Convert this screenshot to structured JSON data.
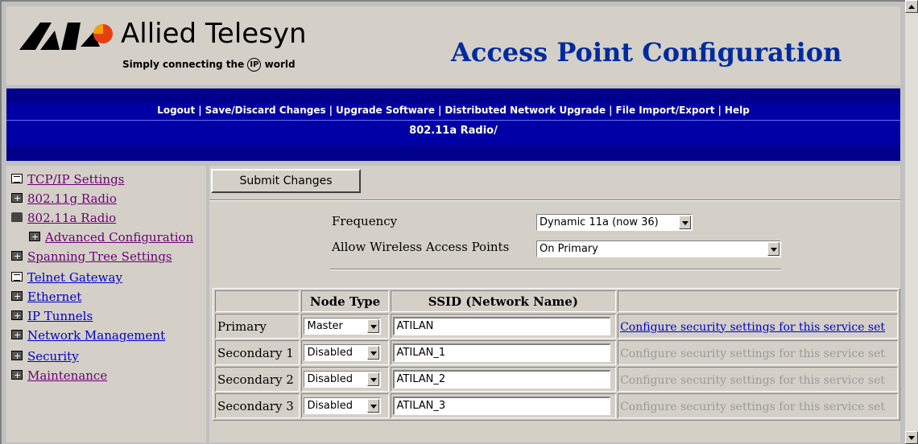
{
  "header": {
    "brand_name": "Allied Telesyn",
    "tagline_pre": "Simply connecting the",
    "tagline_ip": "IP",
    "tagline_post": "world",
    "page_title": "Access Point Configuration"
  },
  "topnav": {
    "links": [
      "Logout",
      "Save/Discard Changes",
      "Upgrade Software",
      "Distributed Network Upgrade",
      "File Import/Export",
      "Help"
    ],
    "section": "802.11a Radio/"
  },
  "sidebar": {
    "items": [
      {
        "label": "TCP/IP Settings",
        "icon": "document-icon"
      },
      {
        "label": "802.11g Radio",
        "icon": "folder-plus-icon"
      },
      {
        "label": "802.11a Radio",
        "icon": "folder-open-icon"
      },
      {
        "label": "Advanced Configuration",
        "icon": "folder-plus-icon"
      },
      {
        "label": "Spanning Tree Settings",
        "icon": "folder-plus-icon"
      },
      {
        "label": "Telnet Gateway",
        "icon": "document-icon"
      },
      {
        "label": "Ethernet",
        "icon": "folder-plus-icon"
      },
      {
        "label": "IP Tunnels",
        "icon": "folder-plus-icon"
      },
      {
        "label": "Network Management",
        "icon": "folder-plus-icon"
      },
      {
        "label": "Security",
        "icon": "folder-plus-icon"
      },
      {
        "label": "Maintenance",
        "icon": "folder-plus-icon"
      }
    ]
  },
  "main": {
    "submit_label": "Submit Changes",
    "frequency_label": "Frequency",
    "frequency_value": "Dynamic 11a (now 36)",
    "allow_label": "Allow Wireless Access Points",
    "allow_value": "On Primary",
    "table": {
      "headers": [
        "",
        "Node Type",
        "SSID (Network Name)",
        ""
      ],
      "rows": [
        {
          "name": "Primary",
          "node_type": "Master",
          "ssid": "ATILAN",
          "link": "Configure security settings for this service set",
          "enabled": true
        },
        {
          "name": "Secondary 1",
          "node_type": "Disabled",
          "ssid": "ATILAN_1",
          "link": "Configure security settings for this service set",
          "enabled": false
        },
        {
          "name": "Secondary 2",
          "node_type": "Disabled",
          "ssid": "ATILAN_2",
          "link": "Configure security settings for this service set",
          "enabled": false
        },
        {
          "name": "Secondary 3",
          "node_type": "Disabled",
          "ssid": "ATILAN_3",
          "link": "Configure security settings for this service set",
          "enabled": false
        }
      ]
    }
  },
  "colors": {
    "title_blue": "#002a9e",
    "bar_blue": "#0000a4",
    "visited_link": "#6b0073",
    "link_blue": "#0000cc"
  }
}
